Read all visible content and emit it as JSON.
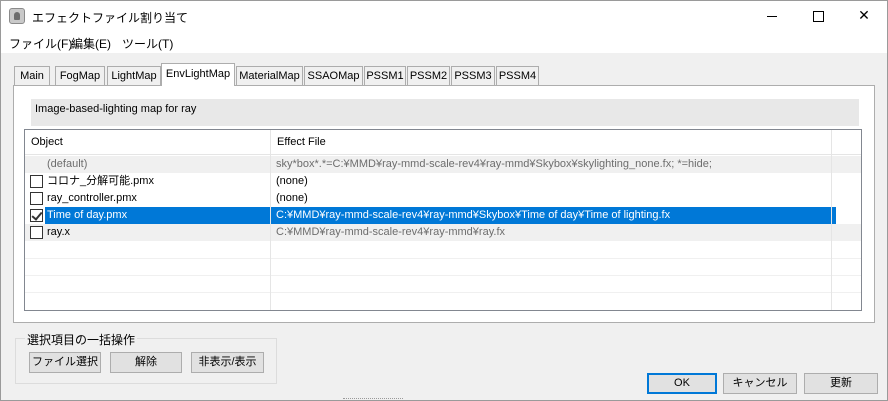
{
  "window": {
    "title": "エフェクトファイル割り当て",
    "controls": {
      "minimize": "minimize",
      "maximize": "maximize",
      "close": "✕"
    }
  },
  "menu": [
    "ファイル(F)",
    "編集(E)",
    "ツール(T)"
  ],
  "tabs": [
    {
      "label": "Main",
      "active": false
    },
    {
      "label": "FogMap",
      "active": false
    },
    {
      "label": "LightMap",
      "active": false
    },
    {
      "label": "EnvLightMap",
      "active": true
    },
    {
      "label": "MaterialMap",
      "active": false
    },
    {
      "label": "SSAOMap",
      "active": false
    },
    {
      "label": "PSSM1",
      "active": false
    },
    {
      "label": "PSSM2",
      "active": false
    },
    {
      "label": "PSSM3",
      "active": false
    },
    {
      "label": "PSSM4",
      "active": false
    }
  ],
  "description": "Image-based-lighting map for ray",
  "columns": {
    "object": "Object",
    "effect_file": "Effect File"
  },
  "rows": [
    {
      "object": "(default)",
      "effect": "sky*box*.*=C:¥MMD¥ray-mmd-scale-rev4¥ray-mmd¥Skybox¥skylighting_none.fx; *=hide;",
      "checkbox": false,
      "checked": false,
      "selected": false
    },
    {
      "object": "コロナ_分解可能.pmx",
      "effect": "(none)",
      "checkbox": true,
      "checked": false,
      "selected": false
    },
    {
      "object": "ray_controller.pmx",
      "effect": "(none)",
      "checkbox": true,
      "checked": false,
      "selected": false
    },
    {
      "object": "Time of day.pmx",
      "effect": "C:¥MMD¥ray-mmd-scale-rev4¥ray-mmd¥Skybox¥Time of day¥Time of lighting.fx",
      "checkbox": true,
      "checked": true,
      "selected": true
    },
    {
      "object": "ray.x",
      "effect": "C:¥MMD¥ray-mmd-scale-rev4¥ray-mmd¥ray.fx",
      "checkbox": true,
      "checked": false,
      "selected": false
    }
  ],
  "bulk": {
    "title": "選択項目の一括操作",
    "file_select": "ファイル選択",
    "release": "解除",
    "toggle_visibility": "非表示/表示"
  },
  "dialog_buttons": {
    "ok": "OK",
    "cancel": "キャンセル",
    "refresh": "更新"
  }
}
